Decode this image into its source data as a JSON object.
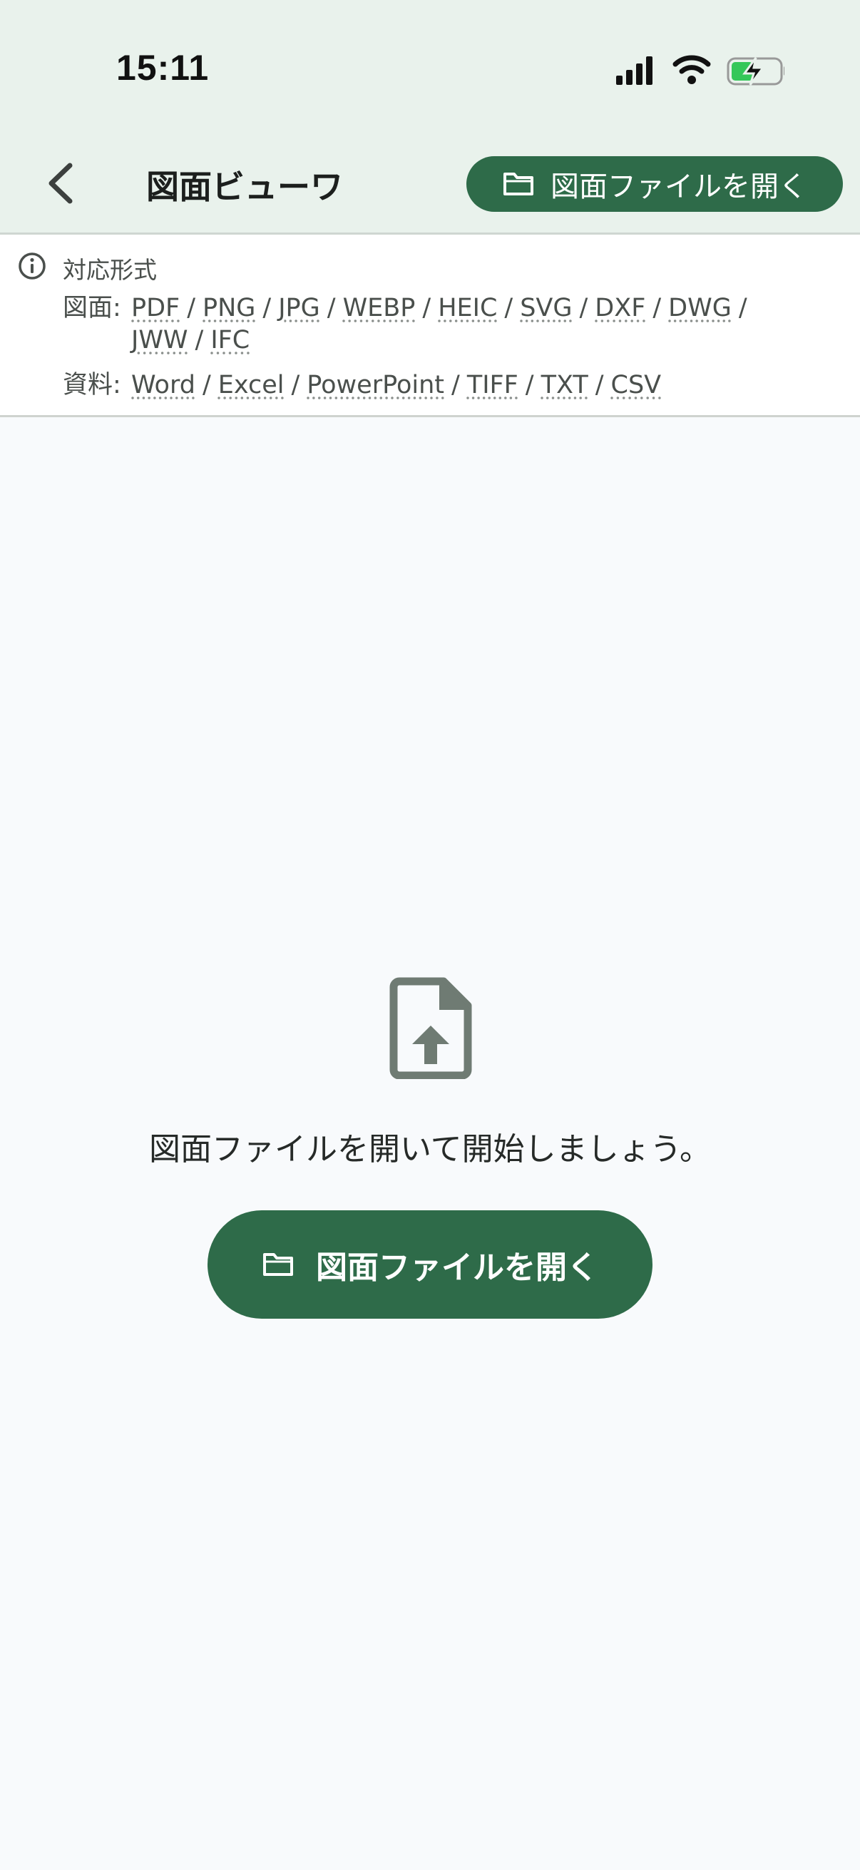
{
  "status_bar": {
    "time": "15:11"
  },
  "header": {
    "title": "図面ビューワ",
    "open_button_label": "図面ファイルを開く"
  },
  "formats": {
    "heading": "対応形式",
    "drawings_label": "図面:",
    "drawings": [
      "PDF",
      "PNG",
      "JPG",
      "WEBP",
      "HEIC",
      "SVG",
      "DXF",
      "DWG",
      "JWW",
      "IFC"
    ],
    "documents_label": "資料:",
    "documents": [
      "Word",
      "Excel",
      "PowerPoint",
      "TIFF",
      "TXT",
      "CSV"
    ]
  },
  "empty_state": {
    "icon": "file-upload-icon",
    "message": "図面ファイルを開いて開始しましょう。",
    "button_label": "図面ファイルを開く"
  },
  "colors": {
    "accent": "#2e6b49",
    "header_bg": "#e9f2ec",
    "battery": "#34c759"
  },
  "format_separator": "/"
}
